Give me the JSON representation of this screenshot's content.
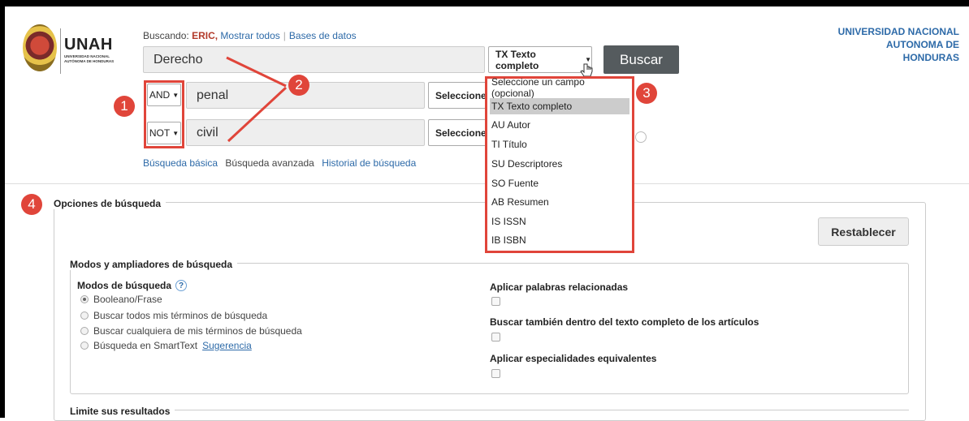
{
  "logo": {
    "title": "UNAH",
    "sub1": "UNIVERSIDAD NACIONAL",
    "sub2": "AUTÓNOMA DE HONDURAS"
  },
  "search": {
    "searching_label": "Buscando:",
    "database": "ERIC,",
    "show_all": "Mostrar todos",
    "databases_link": "Bases de datos",
    "main_query": "Derecho",
    "main_field": "TX Texto completo",
    "search_button": "Buscar",
    "rows": [
      {
        "operator": "AND",
        "query": "penal",
        "field": "Seleccione"
      },
      {
        "operator": "NOT",
        "query": "civil",
        "field": "Seleccione"
      }
    ]
  },
  "nav": {
    "basic": "Búsqueda básica",
    "advanced": "Búsqueda avanzada",
    "history": "Historial de búsqueda"
  },
  "university": {
    "line1": "UNIVERSIDAD NACIONAL",
    "line2": "AUTONOMA DE",
    "line3": "HONDURAS"
  },
  "badges": [
    "1",
    "2",
    "3",
    "4"
  ],
  "field_dropdown": {
    "selected_index": 1,
    "options": [
      "Seleccione un campo (opcional)",
      "TX Texto completo",
      "AU Autor",
      "TI Título",
      "SU Descriptores",
      "SO Fuente",
      "AB Resumen",
      "IS ISSN",
      "IB ISBN"
    ]
  },
  "options": {
    "title": "Opciones de búsqueda",
    "reset_button": "Restablecer",
    "modes_title": "Modos y ampliadores de búsqueda",
    "modes_label": "Modos de búsqueda",
    "help_glyph": "?",
    "modes": [
      {
        "label": "Booleano/Frase",
        "checked": true
      },
      {
        "label": "Buscar todos mis términos de búsqueda",
        "checked": false
      },
      {
        "label": "Buscar cualquiera de mis términos de búsqueda",
        "checked": false
      },
      {
        "label": "Búsqueda en SmartText",
        "checked": false
      }
    ],
    "smarttext_hint": "Sugerencia",
    "expanders": [
      "Aplicar palabras relacionadas",
      "Buscar también dentro del texto completo de los artículos",
      "Aplicar especialidades equivalentes"
    ],
    "limit_title": "Limite sus resultados"
  },
  "colors": {
    "accent": "#e0453a",
    "link": "#2d6aa8",
    "button": "#555b5e"
  }
}
